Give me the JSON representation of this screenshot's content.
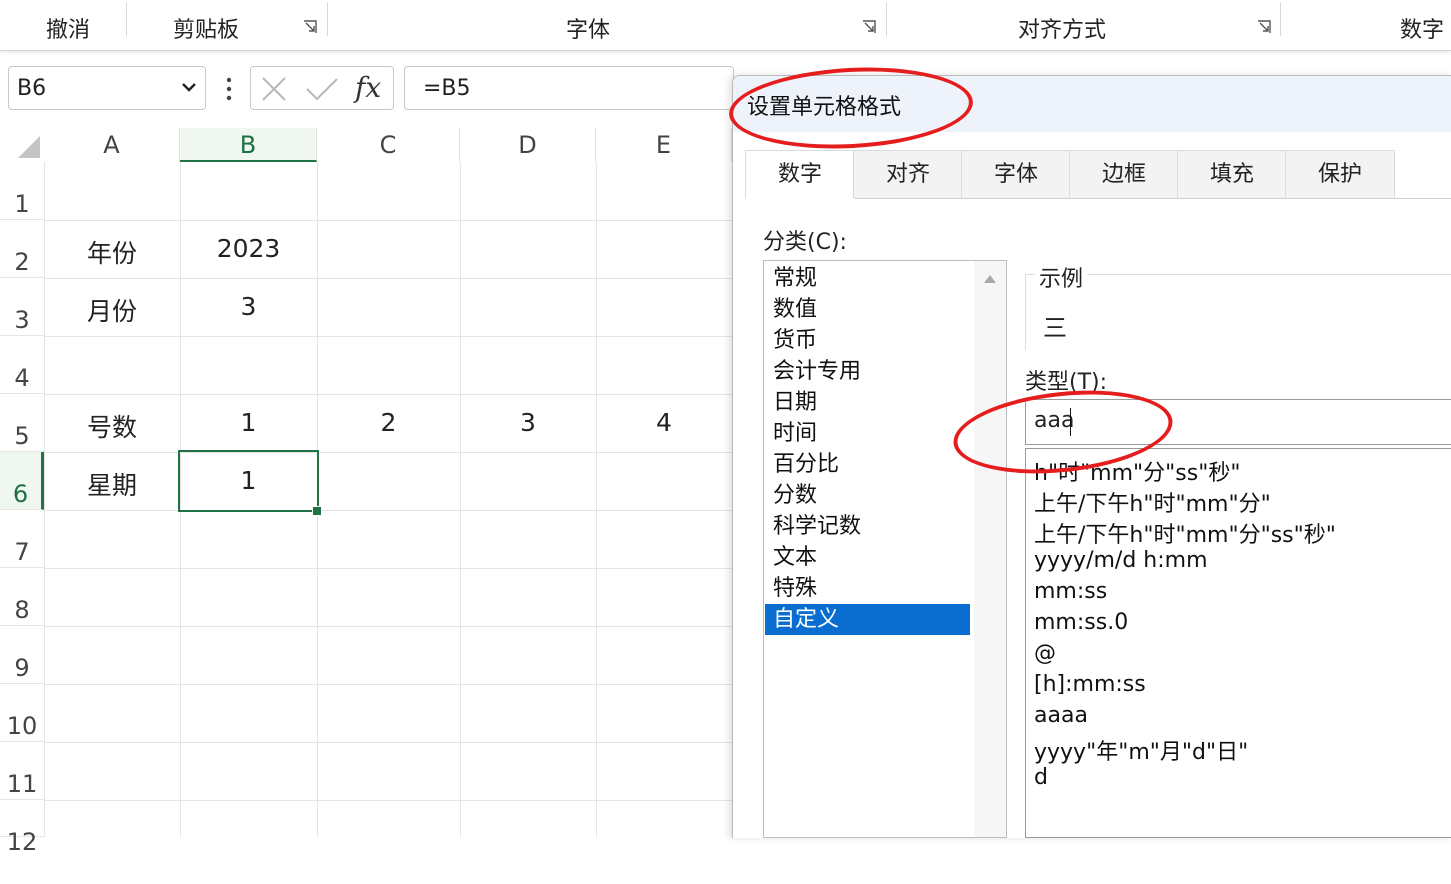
{
  "ribbon": {
    "groups": [
      {
        "label": "撤消"
      },
      {
        "label": "剪贴板"
      },
      {
        "label": "字体"
      },
      {
        "label": "对齐方式"
      },
      {
        "label": "数字"
      }
    ]
  },
  "formula_bar": {
    "name_box": "B6",
    "fx_label": "fx",
    "formula": "=B5"
  },
  "grid": {
    "columns": [
      "A",
      "B",
      "C",
      "D",
      "E"
    ],
    "rows": [
      "1",
      "2",
      "3",
      "4",
      "5",
      "6",
      "7",
      "8",
      "9",
      "10",
      "11",
      "12"
    ],
    "selected_cell": "B6",
    "cells": {
      "A2": "年份",
      "B2": "2023",
      "A3": "月份",
      "B3": "3",
      "A5": "号数",
      "B5": "1",
      "C5": "2",
      "D5": "3",
      "E5": "4",
      "A6": "星期",
      "B6": "1"
    }
  },
  "dialog": {
    "title": "设置单元格格式",
    "tabs": [
      "数字",
      "对齐",
      "字体",
      "边框",
      "填充",
      "保护"
    ],
    "active_tab": "数字",
    "category_label": "分类(C):",
    "categories": [
      "常规",
      "数值",
      "货币",
      "会计专用",
      "日期",
      "时间",
      "百分比",
      "分数",
      "科学记数",
      "文本",
      "特殊",
      "自定义"
    ],
    "selected_category": "自定义",
    "sample_label": "示例",
    "sample_value": "三",
    "type_label": "类型(T):",
    "type_value": "aaa",
    "formats": [
      "h\"时\"mm\"分\"ss\"秒\"",
      "上午/下午h\"时\"mm\"分\"",
      "上午/下午h\"时\"mm\"分\"ss\"秒\"",
      "yyyy/m/d h:mm",
      "mm:ss",
      "mm:ss.0",
      "@",
      "[h]:mm:ss",
      "aaaa",
      "yyyy\"年\"m\"月\"d\"日\"",
      "d"
    ]
  },
  "colors": {
    "excel_green": "#217346",
    "selection_blue": "#0a6ed1",
    "annotation_red": "#e51d1d"
  }
}
